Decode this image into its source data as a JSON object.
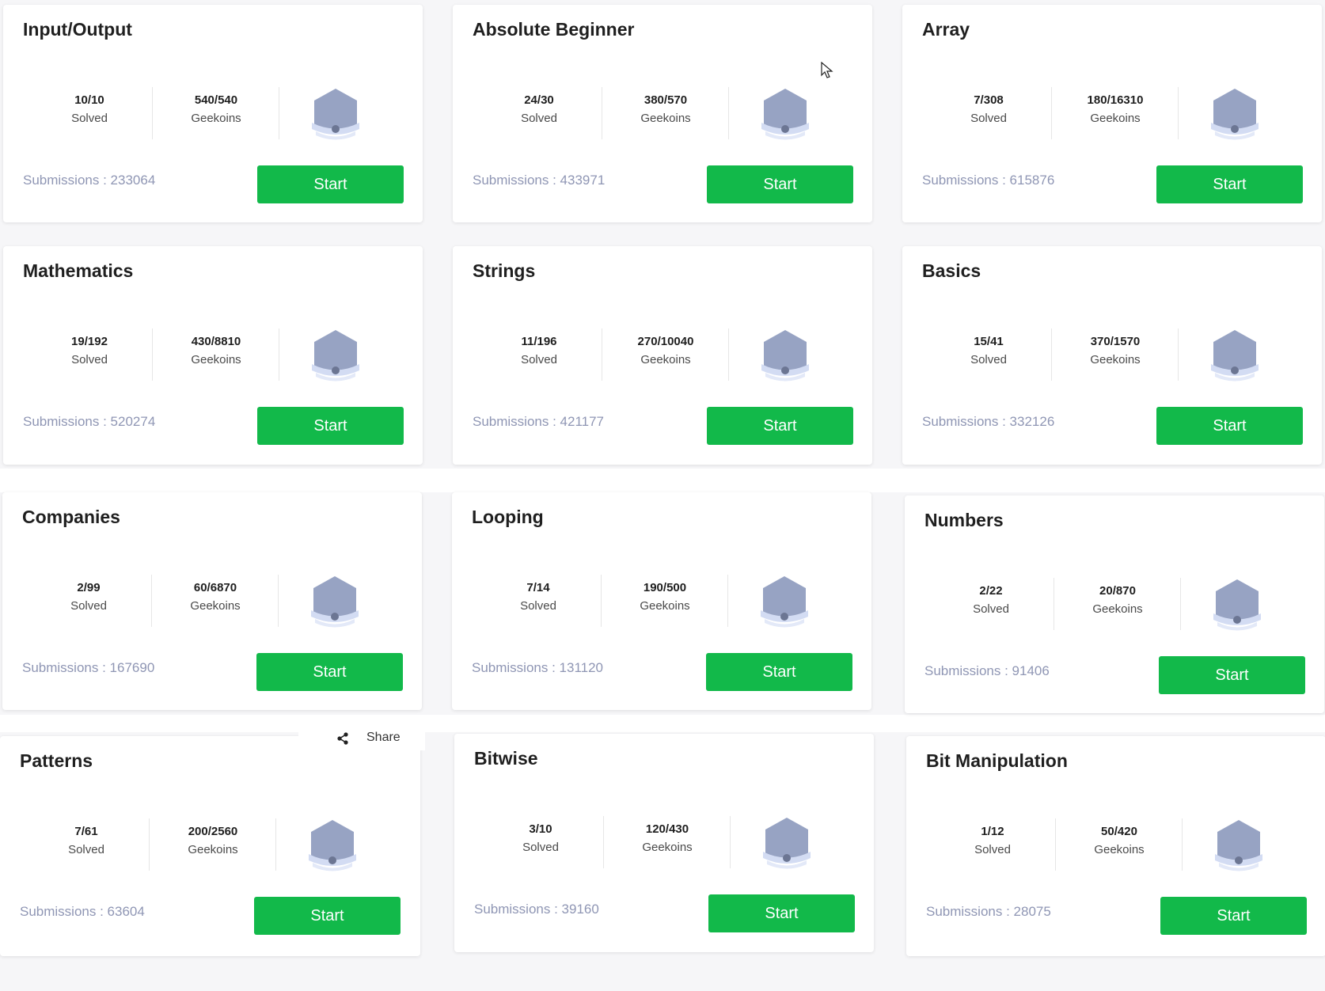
{
  "cards": [
    {
      "title": "Input/Output",
      "solved": "10/10",
      "solved_label": "Solved",
      "geekoins": "540/540",
      "geekoins_label": "Geekoins",
      "submissions": "Submissions : 233064",
      "button": "Start"
    },
    {
      "title": "Absolute Beginner",
      "solved": "24/30",
      "solved_label": "Solved",
      "geekoins": "380/570",
      "geekoins_label": "Geekoins",
      "submissions": "Submissions : 433971",
      "button": "Start"
    },
    {
      "title": "Array",
      "solved": "7/308",
      "solved_label": "Solved",
      "geekoins": "180/16310",
      "geekoins_label": "Geekoins",
      "submissions": "Submissions : 615876",
      "button": "Start"
    },
    {
      "title": "Mathematics",
      "solved": "19/192",
      "solved_label": "Solved",
      "geekoins": "430/8810",
      "geekoins_label": "Geekoins",
      "submissions": "Submissions : 520274",
      "button": "Start"
    },
    {
      "title": "Strings",
      "solved": "11/196",
      "solved_label": "Solved",
      "geekoins": "270/10040",
      "geekoins_label": "Geekoins",
      "submissions": "Submissions : 421177",
      "button": "Start"
    },
    {
      "title": "Basics",
      "solved": "15/41",
      "solved_label": "Solved",
      "geekoins": "370/1570",
      "geekoins_label": "Geekoins",
      "submissions": "Submissions : 332126",
      "button": "Start"
    },
    {
      "title": "Companies",
      "solved": "2/99",
      "solved_label": "Solved",
      "geekoins": "60/6870",
      "geekoins_label": "Geekoins",
      "submissions": "Submissions : 167690",
      "button": "Start"
    },
    {
      "title": "Looping",
      "solved": "7/14",
      "solved_label": "Solved",
      "geekoins": "190/500",
      "geekoins_label": "Geekoins",
      "submissions": "Submissions : 131120",
      "button": "Start"
    },
    {
      "title": "Numbers",
      "solved": "2/22",
      "solved_label": "Solved",
      "geekoins": "20/870",
      "geekoins_label": "Geekoins",
      "submissions": "Submissions : 91406",
      "button": "Start"
    },
    {
      "title": "Patterns",
      "solved": "7/61",
      "solved_label": "Solved",
      "geekoins": "200/2560",
      "geekoins_label": "Geekoins",
      "submissions": "Submissions : 63604",
      "button": "Start"
    },
    {
      "title": "Bitwise",
      "solved": "3/10",
      "solved_label": "Solved",
      "geekoins": "120/430",
      "geekoins_label": "Geekoins",
      "submissions": "Submissions : 39160",
      "button": "Start"
    },
    {
      "title": "Bit Manipulation",
      "solved": "1/12",
      "solved_label": "Solved",
      "geekoins": "50/420",
      "geekoins_label": "Geekoins",
      "submissions": "Submissions : 28075",
      "button": "Start"
    }
  ],
  "share": {
    "label": "Share",
    "icon": "share-icon"
  },
  "colors": {
    "accent": "#12b94a",
    "badge": "#97a3c3",
    "badge_ribbon": "#d3dcf3",
    "submissions_text": "#8f96b4",
    "page_background": "#f6f6f8"
  }
}
